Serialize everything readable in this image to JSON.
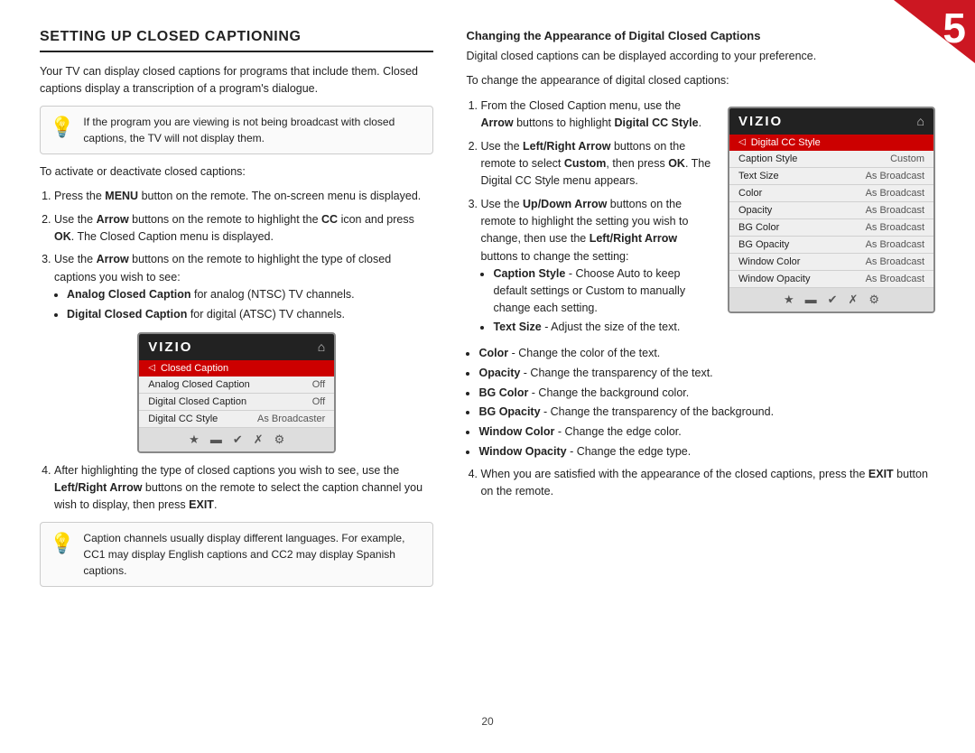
{
  "page": {
    "number": "5",
    "page_footer": "20"
  },
  "left_column": {
    "heading": "SETTING UP CLOSED CAPTIONING",
    "intro_text": "Your TV can display closed captions for programs that include them. Closed captions display a transcription of a program's dialogue.",
    "tip1": {
      "text": "If the program you are viewing is not being broadcast with closed captions, the TV will not display them."
    },
    "activate_text": "To activate or deactivate closed captions:",
    "steps": [
      {
        "id": 1,
        "text": "Press the MENU button on the remote. The on-screen menu is displayed.",
        "bold_parts": [
          "MENU"
        ]
      },
      {
        "id": 2,
        "text": "Use the Arrow buttons on the remote to highlight the CC icon and press OK. The Closed Caption menu is displayed.",
        "bold_parts": [
          "Arrow",
          "OK"
        ]
      },
      {
        "id": 3,
        "text": "Use the Arrow buttons on the remote to highlight the type of closed captions you wish to see:",
        "bold_parts": [
          "Arrow"
        ],
        "bullets": [
          {
            "bold": "Analog Closed Caption",
            "text": " for analog (NTSC) TV channels."
          },
          {
            "bold": "Digital Closed Caption",
            "text": " for digital (ATSC) TV channels."
          }
        ]
      },
      {
        "id": 4,
        "text": "After highlighting the type of closed captions you wish to see, use the Left/Right Arrow buttons on the remote to select the caption channel you wish to display, then press EXIT.",
        "bold_parts": [
          "Left/Right Arrow",
          "EXIT"
        ]
      }
    ],
    "tv_screen": {
      "logo": "VIZIO",
      "menu_title": "Closed Caption",
      "rows": [
        {
          "label": "Analog Closed Caption",
          "value": "Off",
          "highlighted": false
        },
        {
          "label": "Digital Closed Caption",
          "value": "Off",
          "highlighted": false
        },
        {
          "label": "Digital CC Style",
          "value": "As Broadcaster",
          "highlighted": false
        }
      ],
      "footer_icons": [
        "★",
        "□",
        "✔",
        "✗",
        "⚙"
      ]
    },
    "tip2": {
      "text": "Caption channels usually display different languages. For example, CC1 may display English captions and CC2 may display Spanish captions."
    }
  },
  "right_column": {
    "subsection_heading": "Changing the Appearance of Digital Closed Captions",
    "intro_text": "Digital closed captions can be displayed according to your preference.",
    "change_text": "To change the appearance of digital closed captions:",
    "steps": [
      {
        "id": 1,
        "text": "From the Closed Caption menu, use the Arrow buttons to highlight Digital CC Style.",
        "bold_parts": [
          "Arrow",
          "Digital CC Style"
        ]
      },
      {
        "id": 2,
        "text": "Use the Left/Right Arrow buttons on the remote to select Custom, then press OK. The Digital CC Style menu appears.",
        "bold_parts": [
          "Left/Right Arrow",
          "Custom",
          "OK"
        ]
      },
      {
        "id": 3,
        "text": "Use the Up/Down Arrow buttons on the remote to highlight the setting you wish to change, then use the Left/Right Arrow buttons to change the setting:",
        "bold_parts": [
          "Up/Down Arrow",
          "Left/",
          "Right Arrow"
        ],
        "bullets": [
          {
            "bold": "Caption Style",
            "text": " - Choose Auto to keep default settings or Custom to manually change each setting."
          },
          {
            "bold": "Text Size",
            "text": " - Adjust the size of the text."
          }
        ]
      }
    ],
    "bullets_continued": [
      {
        "bold": "Color",
        "text": " - Change the color of the text."
      },
      {
        "bold": "Opacity",
        "text": " - Change the transparency of the text."
      },
      {
        "bold": "BG Color",
        "text": " - Change the background color."
      },
      {
        "bold": "BG Opacity",
        "text": " - Change the transparency of the background."
      },
      {
        "bold": "Window Color",
        "text": " - Change the edge color."
      },
      {
        "bold": "Window Opacity",
        "text": " - Change the edge type."
      }
    ],
    "step4": {
      "id": 4,
      "text": "When you are satisfied with the appearance of the closed captions, press the EXIT button on the remote.",
      "bold_parts": [
        "EXIT"
      ]
    },
    "tv_screen": {
      "logo": "VIZIO",
      "menu_title": "Digital CC Style",
      "rows": [
        {
          "label": "Caption Style",
          "value": "Custom",
          "highlighted": false
        },
        {
          "label": "Text Size",
          "value": "As Broadcast",
          "highlighted": false
        },
        {
          "label": "Color",
          "value": "As Broadcast",
          "highlighted": false
        },
        {
          "label": "Opacity",
          "value": "As Broadcast",
          "highlighted": false
        },
        {
          "label": "BG Color",
          "value": "As Broadcast",
          "highlighted": false
        },
        {
          "label": "BG Opacity",
          "value": "As Broadcast",
          "highlighted": false
        },
        {
          "label": "Window Color",
          "value": "As Broadcast",
          "highlighted": false
        },
        {
          "label": "Window Opacity",
          "value": "As Broadcast",
          "highlighted": false
        }
      ],
      "footer_icons": [
        "★",
        "□",
        "✔",
        "✗",
        "⚙"
      ]
    }
  }
}
